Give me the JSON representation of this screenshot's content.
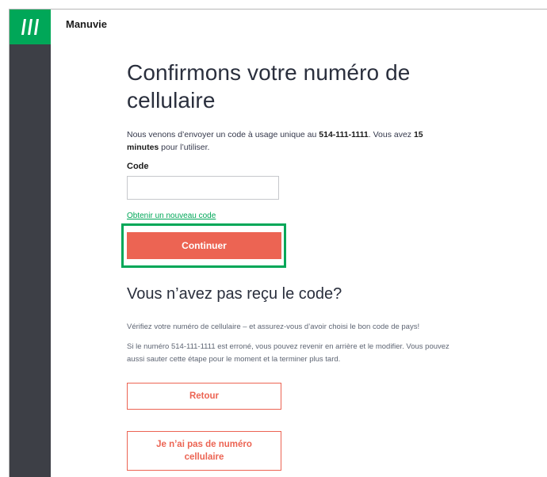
{
  "app": {
    "brand": "Manuvie",
    "accent_color": "#00a758",
    "sidebar_color": "#3d3f46",
    "button_color": "#ec6453",
    "logo_icon": "manulife-logo-icon"
  },
  "confirm": {
    "title": "Confirmons votre numéro de cellulaire",
    "intro_prefix": "Nous venons d’envoyer un code à usage unique au ",
    "phone": "514-111-1111",
    "intro_middle": ". Vous avez ",
    "duration": "15 minutes",
    "intro_suffix": " pour l’utiliser.",
    "code_label": "Code",
    "code_value": "",
    "code_placeholder": "",
    "new_code_link": "Obtenir un nouveau code",
    "continue_label": "Continuer"
  },
  "help": {
    "title": "Vous n’avez pas reçu le code?",
    "para1": "Vérifiez votre numéro de cellulaire – et assurez-vous d’avoir choisi le bon code de pays!",
    "para2": "Si le numéro 514-111-1111 est erroné, vous pouvez revenir en arrière et le modifier. Vous pouvez aussi sauter cette étape pour le moment et la terminer plus tard.",
    "back_label": "Retour",
    "no_phone_label": "Je n’ai pas de numéro cellulaire"
  }
}
